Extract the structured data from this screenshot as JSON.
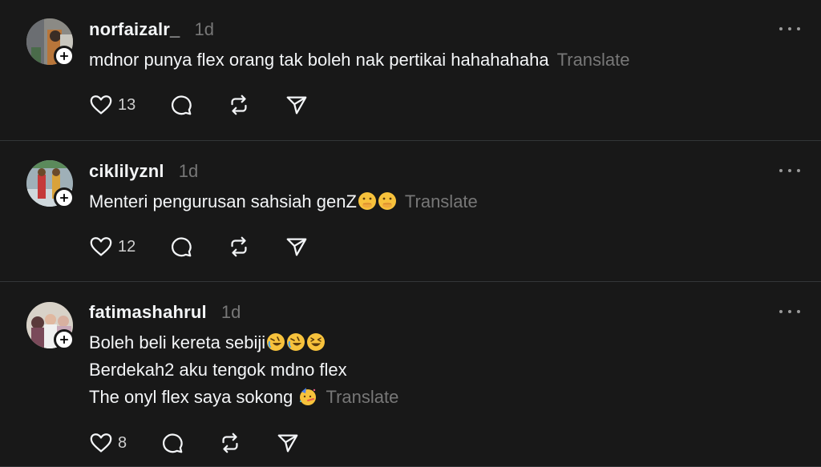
{
  "colors": {
    "background": "#181818",
    "text": "#f3f5f7",
    "muted": "#777777",
    "divider": "#333638"
  },
  "icons": [
    "plus-icon",
    "more-icon",
    "heart-icon",
    "comment-icon",
    "repost-icon",
    "share-icon",
    "face-with-hand-over-mouth-emoji",
    "rolling-on-the-floor-laughing-emoji",
    "grinning-squinting-face-emoji",
    "partying-face-emoji"
  ],
  "replies": [
    {
      "username": "norfaizalr_",
      "time": "1d",
      "lines": [
        "mdnor punya flex orang tak boleh nak pertikai hahahahaha"
      ],
      "translate": "Translate",
      "likes": "13"
    },
    {
      "username": "ciklilyznl",
      "time": "1d",
      "lines": [
        "Menteri pengurusan sahsiah genZ"
      ],
      "translate": "Translate",
      "likes": "12"
    },
    {
      "username": "fatimashahrul",
      "time": "1d",
      "lines": [
        "Boleh beli kereta sebiji",
        "Berdekah2 aku tengok mdno flex",
        "The onyl flex saya sokong "
      ],
      "translate": "Translate",
      "likes": "8"
    }
  ]
}
